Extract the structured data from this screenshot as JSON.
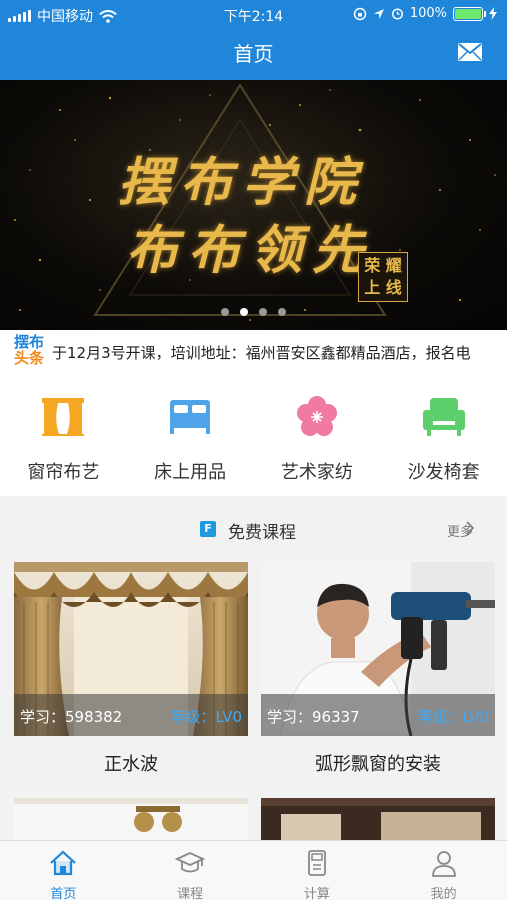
{
  "status_bar": {
    "carrier": "中国移动",
    "time": "下午2:14",
    "battery": "100%"
  },
  "nav": {
    "title": "首页",
    "mail_icon": "mail-icon"
  },
  "banner": {
    "line1": "摆布学院",
    "line2": "布布领先",
    "badge_line1": "荣 耀",
    "badge_line2": "上 线",
    "slides_total": 4,
    "slide_active": 2
  },
  "headline": {
    "logo_top": "摆布",
    "logo_bottom": "头条",
    "text": "于12月3号开课，培训地址：福州晋安区鑫都精品酒店，报名电"
  },
  "categories": [
    {
      "label": "窗帘布艺",
      "icon": "curtain-icon",
      "color": "#f5a623"
    },
    {
      "label": "床上用品",
      "icon": "bed-icon",
      "color": "#4fa3e8"
    },
    {
      "label": "艺术家纺",
      "icon": "flower-icon",
      "color": "#f07aa0"
    },
    {
      "label": "沙发椅套",
      "icon": "sofa-icon",
      "color": "#5ccf6a"
    }
  ],
  "free_courses": {
    "title": "免费课程",
    "badge": "F",
    "more": "更多",
    "items": [
      {
        "name": "正水波",
        "study": "学习：598382",
        "level": "等级：LV0"
      },
      {
        "name": "弧形飘窗的安装",
        "study": "学习：96337",
        "level": "等级：LV0"
      }
    ]
  },
  "tabbar": [
    {
      "label": "首页",
      "icon": "home-icon",
      "active": true
    },
    {
      "label": "课程",
      "icon": "graduation-cap-icon",
      "active": false
    },
    {
      "label": "计算",
      "icon": "calculator-icon",
      "active": false
    },
    {
      "label": "我的",
      "icon": "user-icon",
      "active": false
    }
  ],
  "colors": {
    "primary": "#1f86d9",
    "accent_orange": "#f08a1c",
    "gold": "#e8b84a"
  }
}
